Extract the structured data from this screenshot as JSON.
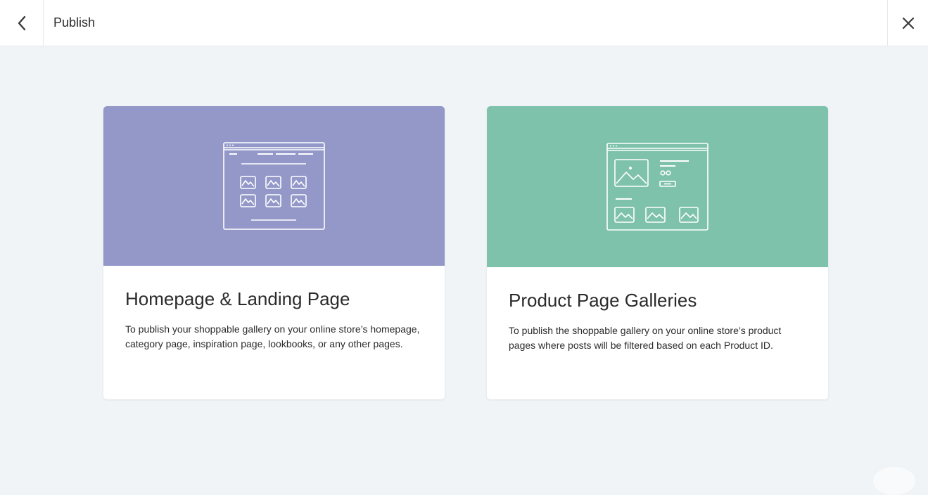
{
  "header": {
    "title": "Publish",
    "back_icon": "chevron-left-icon",
    "close_icon": "close-icon"
  },
  "cards": [
    {
      "title": "Homepage & Landing Page",
      "description": "To publish your shoppable gallery on your online store’s homepage, category page, inspiration page, lookbooks, or any other pages.",
      "hero_color": "#9398c9",
      "illustration_icon": "homepage-grid-layout-icon"
    },
    {
      "title": "Product Page Galleries",
      "description": "To publish the shoppable gallery on your online store’s product pages where posts will be filtered based on each Product ID.",
      "hero_color": "#7fc2ac",
      "illustration_icon": "product-page-layout-icon"
    }
  ],
  "colors": {
    "background": "#f1f4f7",
    "header_bg": "#ffffff",
    "text": "#2b2b2b"
  }
}
